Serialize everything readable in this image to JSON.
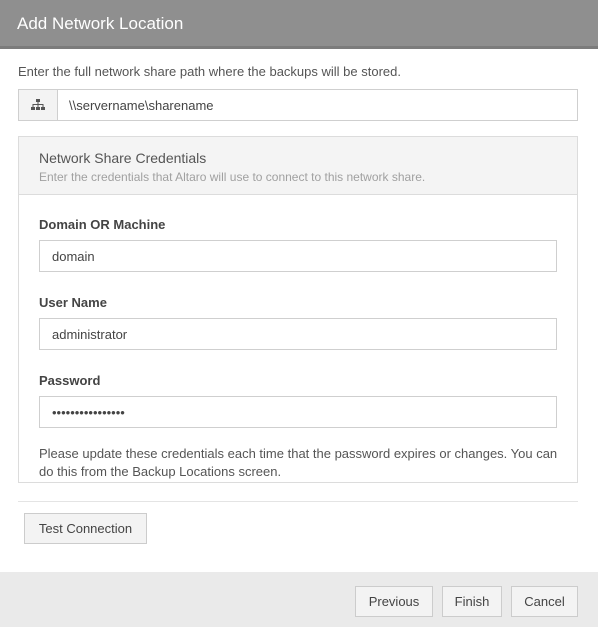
{
  "dialog": {
    "title": "Add Network Location"
  },
  "path": {
    "instruction": "Enter the full network share path where the backups will be stored.",
    "icon": "network-icon",
    "value": "\\\\servername\\sharename"
  },
  "credentials": {
    "title": "Network Share Credentials",
    "subtitle": "Enter the credentials that Altaro will use to connect to this network share.",
    "domain": {
      "label": "Domain OR Machine",
      "value": "domain"
    },
    "username": {
      "label": "User Name",
      "value": "administrator"
    },
    "password": {
      "label": "Password",
      "value": "passwordpassword"
    },
    "note": "Please update these credentials each time that the password expires or changes. You can do this from the Backup Locations screen."
  },
  "actions": {
    "test_connection": "Test Connection",
    "previous": "Previous",
    "finish": "Finish",
    "cancel": "Cancel"
  },
  "colors": {
    "title_bar": "#8f8f8f",
    "footer": "#eaeaea",
    "panel_header": "#f4f4f4"
  }
}
